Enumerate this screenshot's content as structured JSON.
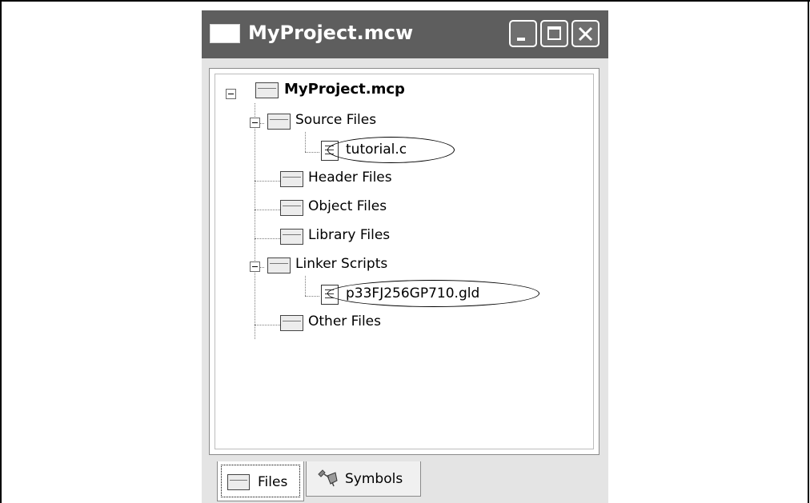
{
  "window": {
    "title": "MyProject.mcw",
    "title_icon": "window-icon",
    "buttons": {
      "minimize_icon": "minimize-icon",
      "maximize_icon": "maximize-icon",
      "close_icon": "close-icon"
    }
  },
  "tree": {
    "root": {
      "label": "MyProject.mcp",
      "icon": "folder-icon"
    },
    "items": [
      {
        "label": "Source Files",
        "icon": "folder-icon",
        "expanded": true
      },
      {
        "label": "tutorial.c",
        "icon": "file-icon",
        "highlighted": true
      },
      {
        "label": "Header Files",
        "icon": "folder-icon"
      },
      {
        "label": "Object Files",
        "icon": "folder-icon"
      },
      {
        "label": "Library Files",
        "icon": "folder-icon"
      },
      {
        "label": "Linker Scripts",
        "icon": "folder-icon",
        "expanded": true
      },
      {
        "label": "p33FJ256GP710.gld",
        "icon": "file-icon",
        "highlighted": true
      },
      {
        "label": "Other Files",
        "icon": "folder-icon"
      }
    ]
  },
  "tabs": [
    {
      "label": "Files",
      "icon": "folder-icon",
      "active": true
    },
    {
      "label": "Symbols",
      "icon": "symbols-icon",
      "active": false
    }
  ],
  "colors": {
    "titlebar": "#5e5e5e",
    "window_bg": "#e4e4e4",
    "panel_bg": "#ffffff"
  }
}
